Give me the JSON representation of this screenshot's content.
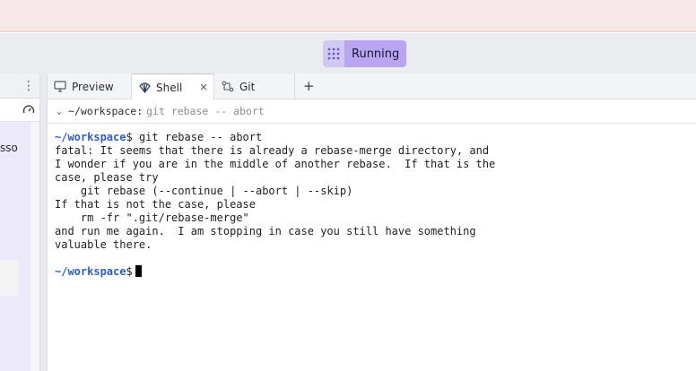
{
  "header": {
    "run_status_label": "Running",
    "run_icon": "grid-dots-icon"
  },
  "left_panel": {
    "partial_text": "sso",
    "menu_icon": "kebab-menu-icon",
    "gauge_icon": "gauge-icon"
  },
  "tabs": [
    {
      "label": "Preview",
      "icon": "monitor-icon"
    },
    {
      "label": "Shell",
      "icon": "shell-icon",
      "active": true
    },
    {
      "label": "Git",
      "icon": "git-branch-icon"
    }
  ],
  "add_tab_label": "+",
  "close_label": "×",
  "breadcrumb": {
    "path": "~/workspace:",
    "command": "git rebase -- abort"
  },
  "terminal": {
    "prompt_path": "~/workspace",
    "prompt_symbol": "$",
    "command": " git rebase -- abort",
    "output_lines": [
      "fatal: It seems that there is already a rebase-merge directory, and",
      "I wonder if you are in the middle of another rebase.  If that is the",
      "case, please try",
      "    git rebase (--continue | --abort | --skip)",
      "If that is not the case, please",
      "    rm -fr \".git/rebase-merge\"",
      "and run me again.  I am stopping in case you still have something",
      "valuable there."
    ]
  },
  "colors": {
    "accent": "#b8a7f0",
    "prompt": "#2e5fc6"
  }
}
